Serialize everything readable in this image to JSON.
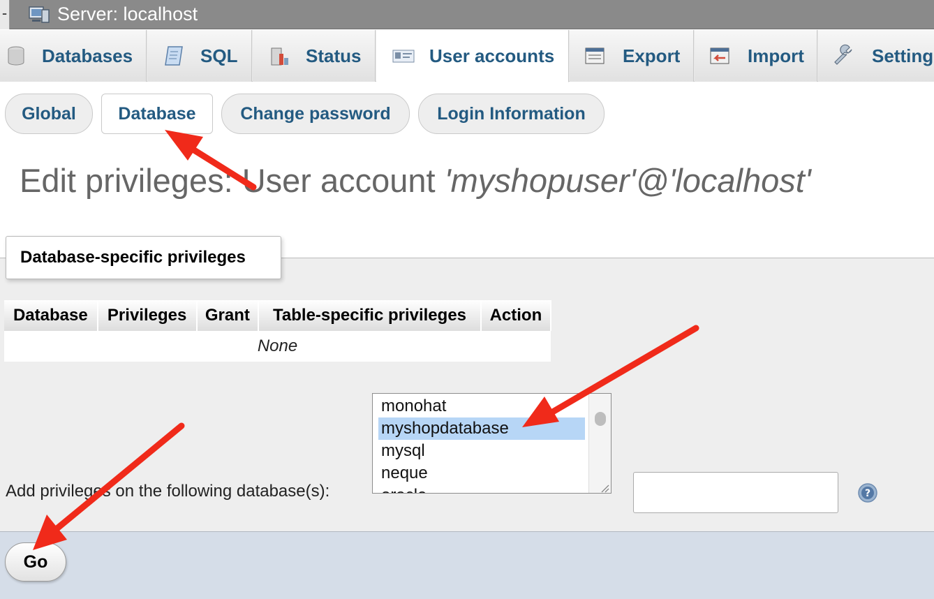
{
  "server_bar": {
    "dash": "-",
    "label": "Server: localhost",
    "icon": "server-icon"
  },
  "top_tabs": [
    {
      "label": "Databases",
      "icon": "database-icon"
    },
    {
      "label": "SQL",
      "icon": "sql-icon"
    },
    {
      "label": "Status",
      "icon": "status-icon"
    },
    {
      "label": "User accounts",
      "icon": "user-accounts-icon",
      "active": true
    },
    {
      "label": "Export",
      "icon": "export-icon"
    },
    {
      "label": "Import",
      "icon": "import-icon"
    },
    {
      "label": "Setting",
      "icon": "wrench-icon"
    }
  ],
  "sub_tabs": [
    {
      "label": "Global"
    },
    {
      "label": "Database",
      "active": true
    },
    {
      "label": "Change password"
    },
    {
      "label": "Login Information"
    }
  ],
  "page_title": {
    "prefix": "Edit privileges: User account ",
    "account": "'myshopuser'@'localhost'"
  },
  "fieldset": {
    "legend": "Database-specific privileges",
    "table": {
      "headers": [
        "Database",
        "Privileges",
        "Grant",
        "Table-specific privileges",
        "Action"
      ],
      "empty_text": "None"
    },
    "add_label": "Add privileges on the following database(s):",
    "db_options": [
      "monohat",
      "myshopdatabase",
      "mysql",
      "neque",
      "oracle"
    ],
    "selected_db": "myshopdatabase",
    "db_input_value": "",
    "help_icon": "help-icon"
  },
  "footer": {
    "go_label": "Go"
  },
  "colors": {
    "link": "#235a81",
    "annotation_arrow": "#f02a1a",
    "selected_option": "#b7d6f6",
    "footer_bg": "#d5dde8"
  }
}
